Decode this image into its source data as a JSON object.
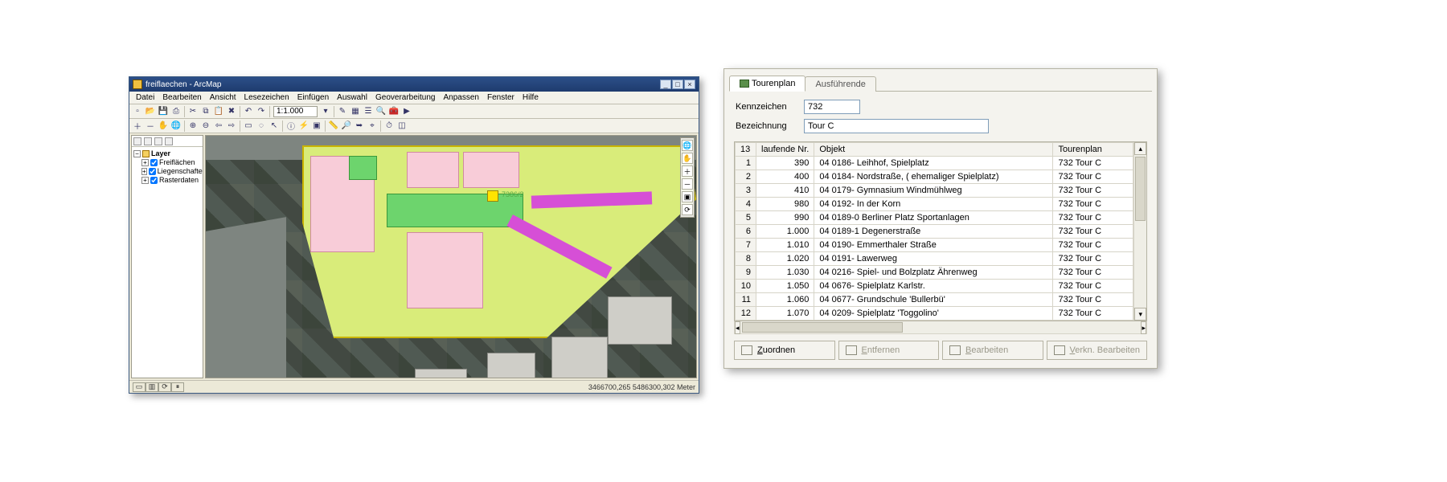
{
  "arcmap": {
    "title": "freiflaechen - ArcMap",
    "menu": [
      "Datei",
      "Bearbeiten",
      "Ansicht",
      "Lesezeichen",
      "Einfügen",
      "Auswahl",
      "Geoverarbeitung",
      "Anpassen",
      "Fenster",
      "Hilfe"
    ],
    "scale": "1:1.000",
    "parcel_label": "7386/2",
    "toc": {
      "root": "Layer",
      "items": [
        "Freiflächen",
        "Liegenschaften",
        "Rasterdaten"
      ]
    },
    "status_coords": "3466700,265 5486300,302 Meter",
    "window_buttons": {
      "min": "_",
      "max": "□",
      "close": "×"
    }
  },
  "tour": {
    "tabs": {
      "t1": "Tourenplan",
      "t2": "Ausführende"
    },
    "labels": {
      "kz": "Kennzeichen",
      "bz": "Bezeichnung"
    },
    "kennzeichen": "732",
    "bezeichnung": "Tour C",
    "count": "13",
    "columns": {
      "c1": "laufende Nr.",
      "c2": "Objekt",
      "c3": "Tourenplan"
    },
    "tourenplan_value": "732 Tour C",
    "rows": [
      {
        "n": "1",
        "nr": "390",
        "obj": "04 0186- Leihhof, Spielplatz"
      },
      {
        "n": "2",
        "nr": "400",
        "obj": "04 0184- Nordstraße, ( ehemaliger Spielplatz)"
      },
      {
        "n": "3",
        "nr": "410",
        "obj": "04 0179- Gymnasium Windmühlweg"
      },
      {
        "n": "4",
        "nr": "980",
        "obj": "04 0192- In der Korn"
      },
      {
        "n": "5",
        "nr": "990",
        "obj": "04 0189-0 Berliner Platz Sportanlagen"
      },
      {
        "n": "6",
        "nr": "1.000",
        "obj": "04 0189-1 Degenerstraße"
      },
      {
        "n": "7",
        "nr": "1.010",
        "obj": "04 0190- Emmerthaler Straße"
      },
      {
        "n": "8",
        "nr": "1.020",
        "obj": "04 0191- Lawerweg"
      },
      {
        "n": "9",
        "nr": "1.030",
        "obj": "04 0216- Spiel- und Bolzplatz Ährenweg"
      },
      {
        "n": "10",
        "nr": "1.050",
        "obj": "04 0676- Spielplatz Karlstr."
      },
      {
        "n": "11",
        "nr": "1.060",
        "obj": "04 0677- Grundschule 'Bullerbü'"
      },
      {
        "n": "12",
        "nr": "1.070",
        "obj": "04 0209- Spielplatz 'Toggolino'"
      }
    ],
    "buttons": {
      "zuordnen": "Zuordnen",
      "entfernen": "Entfernen",
      "bearbeiten": "Bearbeiten",
      "verkn": "Verkn. Bearbeiten"
    }
  }
}
